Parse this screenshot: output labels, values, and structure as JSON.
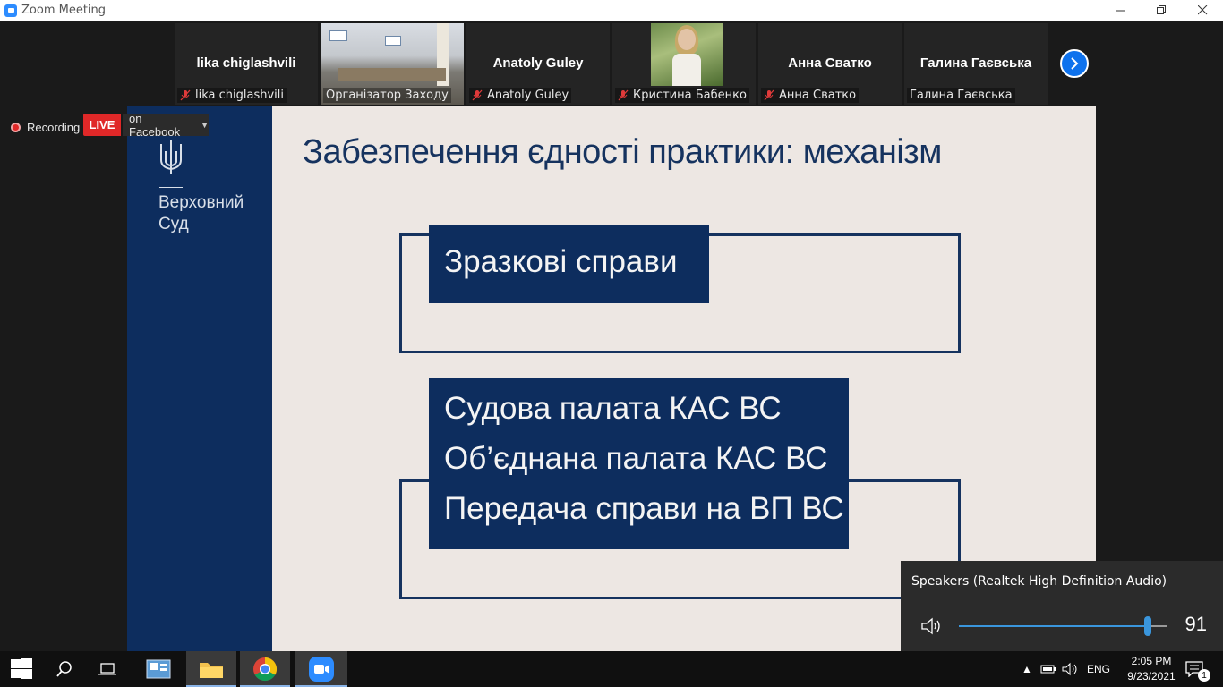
{
  "window": {
    "title": "Zoom Meeting",
    "controls": [
      "minimize",
      "restore",
      "close"
    ]
  },
  "participants": [
    {
      "display_name": "lika chiglashvili",
      "label": "lika chiglashvili",
      "muted": true,
      "video": false
    },
    {
      "display_name": "",
      "label": "Організатор Заходу",
      "muted": false,
      "video": true
    },
    {
      "display_name": "Anatoly Guley",
      "label": "Anatoly Guley",
      "muted": true,
      "video": false
    },
    {
      "display_name": "",
      "label": "Кристина Бабенко",
      "muted": true,
      "video": true
    },
    {
      "display_name": "Анна Сватко",
      "label": "Анна Сватко",
      "muted": true,
      "video": false
    },
    {
      "display_name": "Галина Гаєвська",
      "label": "Галина Гаєвська",
      "muted": false,
      "video": false
    }
  ],
  "status": {
    "recording": "Recording",
    "live": "LIVE",
    "stream_target": "on Facebook"
  },
  "slide": {
    "org_name_line1": "Верховний",
    "org_name_line2": "Суд",
    "title": "Забезпечення єдності практики: механізм",
    "box1": "Зразкові справи",
    "box2_lines": [
      "Судова палата КАС ВС",
      "Об’єднана палата КАС ВС",
      "Передача справи на ВП ВС"
    ]
  },
  "volume_flyout": {
    "device": "Speakers (Realtek High Definition Audio)",
    "level": 91
  },
  "taskbar": {
    "language": "ENG",
    "time": "2:05 PM",
    "date": "9/23/2021",
    "notification_count": "1"
  },
  "colors": {
    "zoom_blue": "#0e72ed",
    "live_red": "#e02828",
    "slide_navy": "#0d2d5e",
    "slide_bg": "#ede7e3",
    "active_speaker": "#a8c542"
  }
}
